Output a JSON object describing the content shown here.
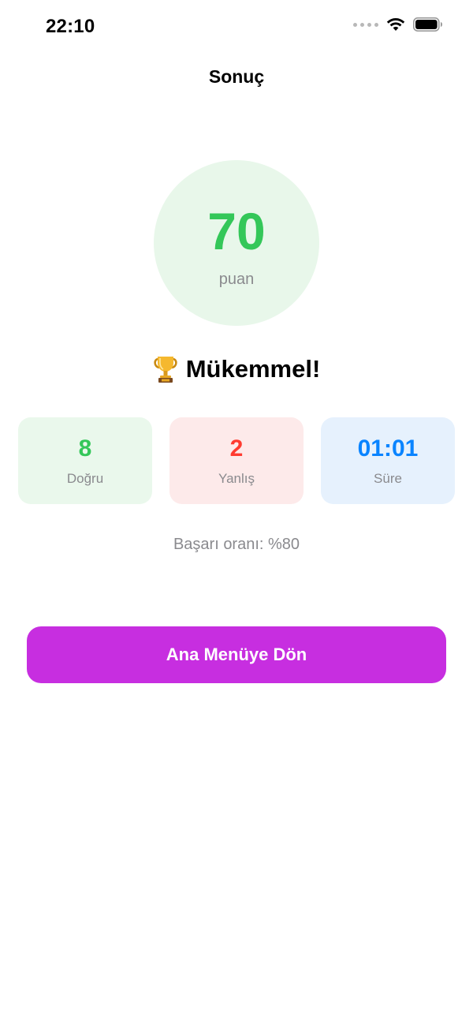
{
  "status_bar": {
    "time": "22:10",
    "icons": [
      "signal-dots-icon",
      "wifi-icon",
      "battery-icon"
    ]
  },
  "header": {
    "title": "Sonuç"
  },
  "score": {
    "value": "70",
    "unit": "puan",
    "color": "#34c759"
  },
  "result": {
    "icon": "trophy-icon",
    "title": "Mükemmel!"
  },
  "stats": [
    {
      "value": "8",
      "label": "Doğru",
      "color": "#34c759"
    },
    {
      "value": "2",
      "label": "Yanlış",
      "color": "#ff3b30"
    },
    {
      "value": "01:01",
      "label": "Süre",
      "color": "#0a84ff"
    }
  ],
  "success_rate": "Başarı oranı: %80",
  "main_menu_button": {
    "label": "Ana Menüye Dön",
    "color": "#c72ee0"
  }
}
